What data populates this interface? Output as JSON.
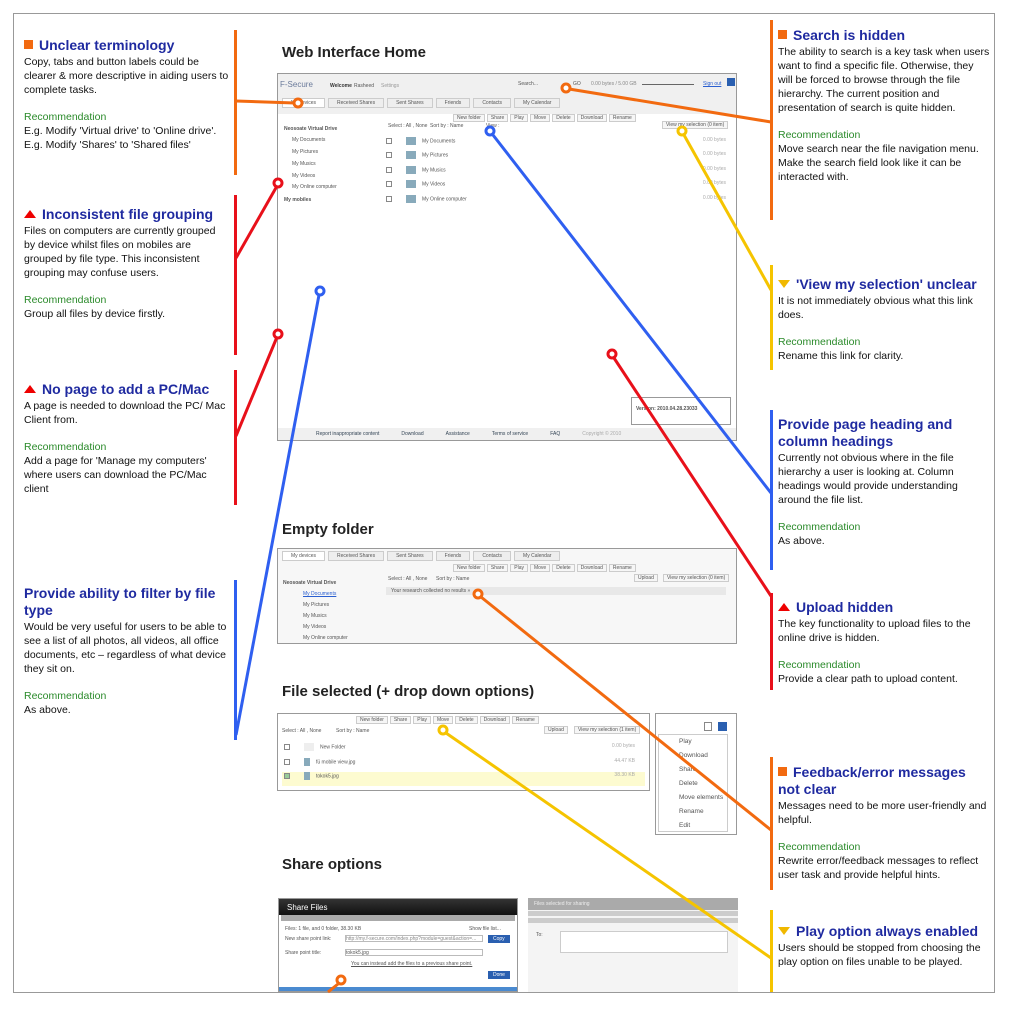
{
  "sections": {
    "home": "Web Interface Home",
    "empty": "Empty folder",
    "selected": "File selected (+ drop down options)",
    "share": "Share options"
  },
  "annotations": [
    {
      "title": "Unclear terminology",
      "body": "Copy, tabs and button labels could be clearer & more descriptive in aiding users to complete tasks.",
      "rec_label": "Recommendation",
      "rec": "E.g. Modify 'Virtual drive' to 'Online drive'.\nE.g. Modify 'Shares' to 'Shared files'",
      "color": "#f26a10",
      "icon": "orange-square"
    },
    {
      "title": "Inconsistent file grouping",
      "body": "Files on computers are currently grouped by device whilst files on mobiles are grouped by file type. This inconsistent grouping may confuse users.",
      "rec_label": "Recommendation",
      "rec": "Group all files by device firstly.",
      "color": "#e8101a",
      "icon": "red-triangle"
    },
    {
      "title": "No page to add a PC/Mac",
      "body": "A page is needed to download the PC/ Mac Client from.",
      "rec_label": "Recommendation",
      "rec": "Add a page for 'Manage my computers' where users can download the PC/Mac client",
      "color": "#e8101a",
      "icon": "red-triangle"
    },
    {
      "title": "Provide ability to filter by file type",
      "body": "Would be very useful for users to be able to see a list of all photos, all videos, all office documents, etc – regardless of what device they sit on.",
      "rec_label": "Recommendation",
      "rec": "As above.",
      "color": "#2f5ff0",
      "icon": "none"
    },
    {
      "title": "Search is hidden",
      "body": "The ability to search is a key task when users want to find a specific file. Otherwise, they will be forced to browse through the file hierarchy. The current position and presentation of search is quite hidden.",
      "rec_label": "Recommendation",
      "rec": "Move search near the file navigation menu.\nMake the search field look like it can be interacted with.",
      "color": "#f26a10",
      "icon": "orange-square"
    },
    {
      "title": "'View my selection' unclear",
      "body": "It is not immediately obvious what this link does.",
      "rec_label": "Recommendation",
      "rec": "Rename this link for clarity.",
      "color": "#f5c400",
      "icon": "yellow-triangle-down"
    },
    {
      "title": "Provide page heading and column headings",
      "body": "Currently not obvious where in the file hierarchy a user is looking at. Column headings would provide understanding around the file list.",
      "rec_label": "Recommendation",
      "rec": "As above.",
      "color": "#2f5ff0",
      "icon": "none"
    },
    {
      "title": "Upload hidden",
      "body": "The key functionality to upload files to the online drive is hidden.",
      "rec_label": "Recommendation",
      "rec": "Provide a clear path to upload content.",
      "color": "#e8101a",
      "icon": "red-triangle"
    },
    {
      "title": "Feedback/error messages not clear",
      "body": "Messages need to be more user-friendly and helpful.",
      "rec_label": "Recommendation",
      "rec": "Rewrite error/feedback messages to reflect user task and provide helpful hints.",
      "color": "#f26a10",
      "icon": "orange-square"
    },
    {
      "title": "Play option always enabled",
      "body": "Users should be stopped from choosing the play option on files unable to be played.",
      "rec_label": "Recommendation",
      "rec": "",
      "color": "#f5c400",
      "icon": "yellow-triangle-down"
    }
  ],
  "app": {
    "logo": "F-Secure",
    "welcome": "Welcome",
    "user": "Rasheed",
    "settings": "Settings",
    "search": "Search...",
    "go": "GO",
    "quota": "0.00 bytes / 5.00 GB",
    "signout": "Sign out",
    "tabs": [
      "My devices",
      "Received Shares",
      "Sent Shares",
      "Friends",
      "Contacts",
      "My Calendar"
    ],
    "toolbar": [
      "New folder",
      "Share",
      "Play",
      "Move",
      "Delete",
      "Download",
      "Rename"
    ],
    "select": "Select : All , None",
    "sort": "Sort by : Name",
    "view": "View :",
    "view_selection": "View my selection (0 item)",
    "upload": "Upload",
    "tree_root": "Neosoate Virtual Drive",
    "tree": [
      "My Documents",
      "My Pictures",
      "My Musics",
      "My Videos",
      "My Online computer"
    ],
    "mobiles": "My mobiles",
    "files": [
      {
        "name": "My Documents",
        "size": "0.00 bytes"
      },
      {
        "name": "My Pictures",
        "size": "0.00 bytes"
      },
      {
        "name": "My Musics",
        "size": "0.00 bytes"
      },
      {
        "name": "My Videos",
        "size": "0.00 bytes"
      },
      {
        "name": "My Online computer",
        "size": "0.00 bytes"
      }
    ],
    "version": "Version: 2010.04.28.23033",
    "footer": [
      "Report inappropriate content",
      "Download",
      "Assistance",
      "Terms of service",
      "FAQ",
      "Copyright © 2010"
    ],
    "empty_msg": "Your research collected no results »",
    "sel_view": "View my selection (1 item)",
    "sel_files": [
      {
        "name": "New Folder",
        "size": "0.00 bytes",
        "checked": false
      },
      {
        "name": "fü mobile view.jpg",
        "size": "44.47 KB",
        "checked": false
      },
      {
        "name": "tokok5.jpg",
        "size": "38.30 KB",
        "checked": true
      }
    ],
    "dropdown": [
      "Play",
      "Download",
      "Share",
      "Delete",
      "Move elements",
      "Rename",
      "Edit"
    ],
    "share_title": "Share Files",
    "share_files": "Files: 1 file, and 0 folder, 38.30 KB",
    "show_list": "Show file list...",
    "share_link_label": "New share point link:",
    "share_link": "http://my.f-secure.com/index.php?module=guest&action=...",
    "share_title_label": "Share point title:",
    "share_title_val": "tokok5.jpg",
    "share_prev": "You can instead add the files to a previous share point.",
    "share_copy": "Copy",
    "share_done": "Done",
    "share2_title": "Files selected for sharing",
    "to": "To:"
  }
}
